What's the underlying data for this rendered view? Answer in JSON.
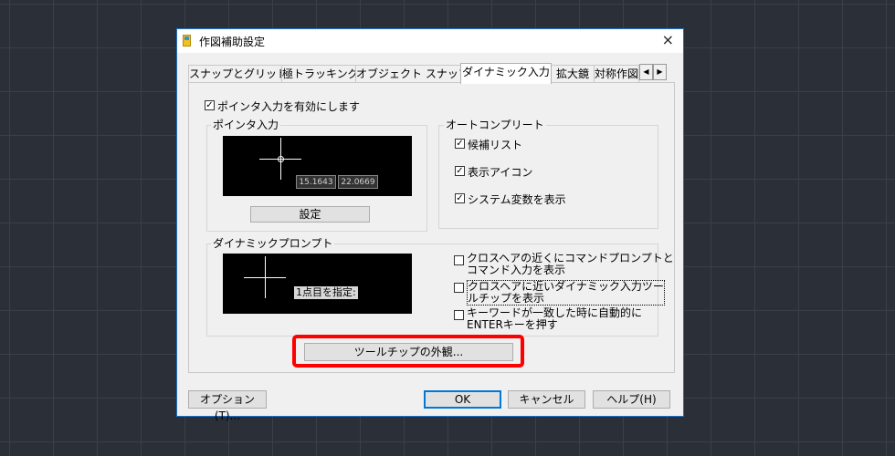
{
  "window": {
    "title": "作図補助設定",
    "close_icon": "×"
  },
  "tabs": {
    "items": [
      "スナップとグリッド",
      "極トラッキング",
      "オブジェクト スナップ",
      "ダイナミック入力",
      "拡大鏡",
      "対称作図"
    ],
    "scroll_left": "◀",
    "scroll_right": "▶"
  },
  "enable_pointer_input": {
    "label": "ポインタ入力を有効にします",
    "checked": true
  },
  "pointer_input": {
    "group_label": "ポインタ入力",
    "coord_x": "15.1643",
    "coord_y": "22.0669",
    "settings_button": "設定"
  },
  "autocomplete": {
    "group_label": "オートコンプリート",
    "options": [
      {
        "label": "候補リスト",
        "checked": true
      },
      {
        "label": "表示アイコン",
        "checked": true
      },
      {
        "label": "システム変数を表示",
        "checked": true
      }
    ]
  },
  "dynamic_prompt": {
    "group_label": "ダイナミックプロンプト",
    "prompt_text": "1点目を指定:",
    "options": [
      {
        "line1": "クロスヘアの近くにコマンドプロンプトと",
        "line2": "コマンド入力を表示",
        "checked": false
      },
      {
        "line1": "クロスヘアに近いダイナミック入力ツー",
        "line2": "ルチップを表示",
        "checked": false
      },
      {
        "line1": "キーワードが一致した時に自動的に",
        "line2": "ENTERキーを押す",
        "checked": false
      }
    ]
  },
  "tooltip_appearance_button": "ツールチップの外観...",
  "footer": {
    "options_button": "オプション(T)...",
    "ok_button": "OK",
    "cancel_button": "キャンセル",
    "help_button": "ヘルプ(H)"
  },
  "colors": {
    "highlight": "#ff0000",
    "accent": "#0078d7"
  }
}
